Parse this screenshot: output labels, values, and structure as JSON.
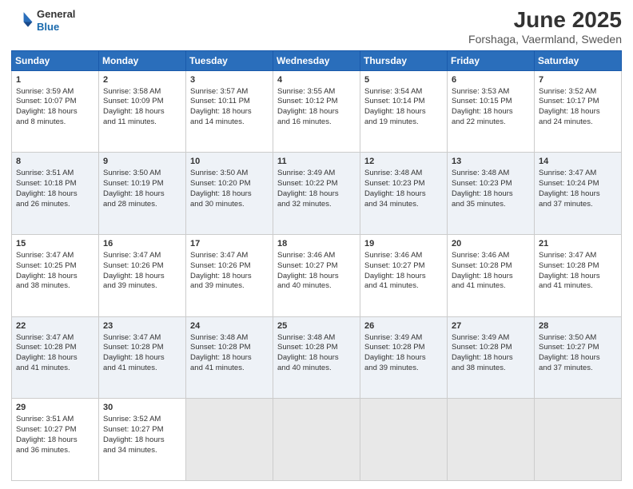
{
  "logo": {
    "general": "General",
    "blue": "Blue"
  },
  "title": {
    "month": "June 2025",
    "location": "Forshaga, Vaermland, Sweden"
  },
  "days": [
    "Sunday",
    "Monday",
    "Tuesday",
    "Wednesday",
    "Thursday",
    "Friday",
    "Saturday"
  ],
  "weeks": [
    [
      {
        "day": "1",
        "sunrise": "3:59 AM",
        "sunset": "10:07 PM",
        "daylight": "18 hours and 8 minutes."
      },
      {
        "day": "2",
        "sunrise": "3:58 AM",
        "sunset": "10:09 PM",
        "daylight": "18 hours and 11 minutes."
      },
      {
        "day": "3",
        "sunrise": "3:57 AM",
        "sunset": "10:11 PM",
        "daylight": "18 hours and 14 minutes."
      },
      {
        "day": "4",
        "sunrise": "3:55 AM",
        "sunset": "10:12 PM",
        "daylight": "18 hours and 16 minutes."
      },
      {
        "day": "5",
        "sunrise": "3:54 AM",
        "sunset": "10:14 PM",
        "daylight": "18 hours and 19 minutes."
      },
      {
        "day": "6",
        "sunrise": "3:53 AM",
        "sunset": "10:15 PM",
        "daylight": "18 hours and 22 minutes."
      },
      {
        "day": "7",
        "sunrise": "3:52 AM",
        "sunset": "10:17 PM",
        "daylight": "18 hours and 24 minutes."
      }
    ],
    [
      {
        "day": "8",
        "sunrise": "3:51 AM",
        "sunset": "10:18 PM",
        "daylight": "18 hours and 26 minutes."
      },
      {
        "day": "9",
        "sunrise": "3:50 AM",
        "sunset": "10:19 PM",
        "daylight": "18 hours and 28 minutes."
      },
      {
        "day": "10",
        "sunrise": "3:50 AM",
        "sunset": "10:20 PM",
        "daylight": "18 hours and 30 minutes."
      },
      {
        "day": "11",
        "sunrise": "3:49 AM",
        "sunset": "10:22 PM",
        "daylight": "18 hours and 32 minutes."
      },
      {
        "day": "12",
        "sunrise": "3:48 AM",
        "sunset": "10:23 PM",
        "daylight": "18 hours and 34 minutes."
      },
      {
        "day": "13",
        "sunrise": "3:48 AM",
        "sunset": "10:23 PM",
        "daylight": "18 hours and 35 minutes."
      },
      {
        "day": "14",
        "sunrise": "3:47 AM",
        "sunset": "10:24 PM",
        "daylight": "18 hours and 37 minutes."
      }
    ],
    [
      {
        "day": "15",
        "sunrise": "3:47 AM",
        "sunset": "10:25 PM",
        "daylight": "18 hours and 38 minutes."
      },
      {
        "day": "16",
        "sunrise": "3:47 AM",
        "sunset": "10:26 PM",
        "daylight": "18 hours and 39 minutes."
      },
      {
        "day": "17",
        "sunrise": "3:47 AM",
        "sunset": "10:26 PM",
        "daylight": "18 hours and 39 minutes."
      },
      {
        "day": "18",
        "sunrise": "3:46 AM",
        "sunset": "10:27 PM",
        "daylight": "18 hours and 40 minutes."
      },
      {
        "day": "19",
        "sunrise": "3:46 AM",
        "sunset": "10:27 PM",
        "daylight": "18 hours and 41 minutes."
      },
      {
        "day": "20",
        "sunrise": "3:46 AM",
        "sunset": "10:28 PM",
        "daylight": "18 hours and 41 minutes."
      },
      {
        "day": "21",
        "sunrise": "3:47 AM",
        "sunset": "10:28 PM",
        "daylight": "18 hours and 41 minutes."
      }
    ],
    [
      {
        "day": "22",
        "sunrise": "3:47 AM",
        "sunset": "10:28 PM",
        "daylight": "18 hours and 41 minutes."
      },
      {
        "day": "23",
        "sunrise": "3:47 AM",
        "sunset": "10:28 PM",
        "daylight": "18 hours and 41 minutes."
      },
      {
        "day": "24",
        "sunrise": "3:48 AM",
        "sunset": "10:28 PM",
        "daylight": "18 hours and 41 minutes."
      },
      {
        "day": "25",
        "sunrise": "3:48 AM",
        "sunset": "10:28 PM",
        "daylight": "18 hours and 40 minutes."
      },
      {
        "day": "26",
        "sunrise": "3:49 AM",
        "sunset": "10:28 PM",
        "daylight": "18 hours and 39 minutes."
      },
      {
        "day": "27",
        "sunrise": "3:49 AM",
        "sunset": "10:28 PM",
        "daylight": "18 hours and 38 minutes."
      },
      {
        "day": "28",
        "sunrise": "3:50 AM",
        "sunset": "10:27 PM",
        "daylight": "18 hours and 37 minutes."
      }
    ],
    [
      {
        "day": "29",
        "sunrise": "3:51 AM",
        "sunset": "10:27 PM",
        "daylight": "18 hours and 36 minutes."
      },
      {
        "day": "30",
        "sunrise": "3:52 AM",
        "sunset": "10:27 PM",
        "daylight": "18 hours and 34 minutes."
      },
      null,
      null,
      null,
      null,
      null
    ]
  ]
}
